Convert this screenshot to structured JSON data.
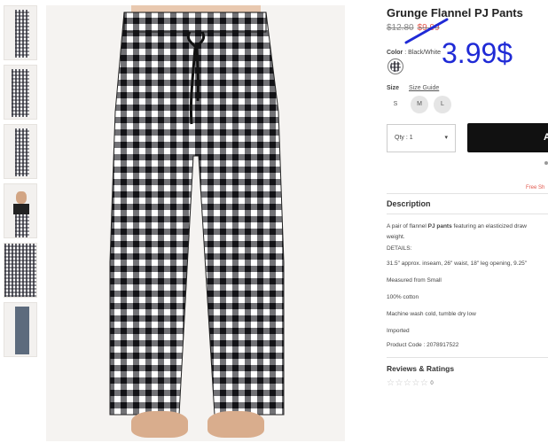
{
  "thumbnails": [
    {
      "label": "thumbnail-1"
    },
    {
      "label": "thumbnail-2"
    },
    {
      "label": "thumbnail-3"
    },
    {
      "label": "thumbnail-4"
    },
    {
      "label": "thumbnail-5"
    },
    {
      "label": "thumbnail-6"
    }
  ],
  "product": {
    "title": "Grunge Flannel PJ Pants",
    "price_regular": "$12.80",
    "price_sale": "$9.99",
    "price_handwritten": "3.99$",
    "color_label": "Color",
    "color_value": "Black/White",
    "size_label": "Size",
    "size_guide": "Size Guide",
    "sizes": [
      "S",
      "M",
      "L"
    ],
    "qty_label": "Qty : 1",
    "qty_caret": "▾",
    "add_button": "A",
    "free_shipping": "Free Sh"
  },
  "description": {
    "title": "Description",
    "line1_pre": "A pair of flannel ",
    "line1_bold": "PJ pants",
    "line1_post": " featuring an elasticized draw",
    "line2": "weight.",
    "details_label": "DETAILS:",
    "measurements": "31.5\" approx. inseam, 26\" waist, 18\" leg opening, 9.25\"",
    "measured_from": "Measured from Small",
    "material": "100% cotton",
    "care": "Machine wash cold, tumble dry low",
    "origin": "Imported",
    "product_code": "Product Code : 2078917522"
  },
  "reviews": {
    "title": "Reviews & Ratings",
    "stars": "☆☆☆☆☆",
    "count": "0"
  },
  "colors": {
    "price_accent": "#1f2ad6",
    "sale_red": "#e2574c",
    "button_dark": "#111111"
  }
}
